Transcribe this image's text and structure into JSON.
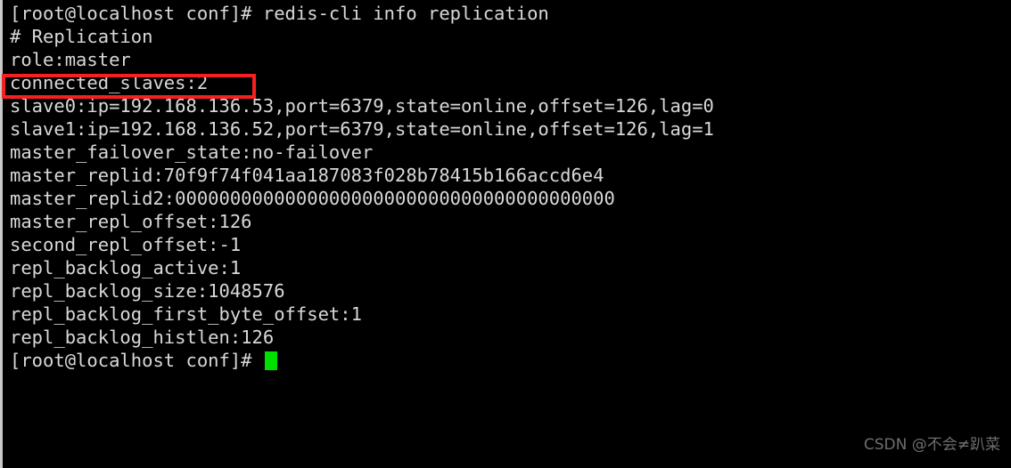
{
  "terminal": {
    "background_color": "#000000",
    "foreground_color": "#d8d8d8",
    "cursor_color": "#00e000",
    "lines": [
      {
        "id": "command-prompt-line",
        "text": "[root@localhost conf]# redis-cli info replication"
      },
      {
        "id": "section-header-line",
        "text": "# Replication"
      },
      {
        "id": "role-line",
        "text": "role:master"
      },
      {
        "id": "connected-slaves-line",
        "text": "connected_slaves:2"
      },
      {
        "id": "slave0-line",
        "text": "slave0:ip=192.168.136.53,port=6379,state=online,offset=126,lag=0"
      },
      {
        "id": "slave1-line",
        "text": "slave1:ip=192.168.136.52,port=6379,state=online,offset=126,lag=1"
      },
      {
        "id": "master-failover-state-line",
        "text": "master_failover_state:no-failover"
      },
      {
        "id": "master-replid-line",
        "text": "master_replid:70f9f74f041aa187083f028b78415b166accd6e4"
      },
      {
        "id": "master-replid2-line",
        "text": "master_replid2:0000000000000000000000000000000000000000"
      },
      {
        "id": "master-repl-offset-line",
        "text": "master_repl_offset:126"
      },
      {
        "id": "second-repl-offset-line",
        "text": "second_repl_offset:-1"
      },
      {
        "id": "repl-backlog-active-line",
        "text": "repl_backlog_active:1"
      },
      {
        "id": "repl-backlog-size-line",
        "text": "repl_backlog_size:1048576"
      },
      {
        "id": "repl-backlog-first-byte-offset-line",
        "text": "repl_backlog_first_byte_offset:1"
      },
      {
        "id": "repl-backlog-histlen-line",
        "text": "repl_backlog_histlen:126"
      }
    ],
    "final_prompt": "[root@localhost conf]# "
  },
  "annotation": {
    "highlight_color": "#f52020",
    "highlight_target": "connected_slaves:2"
  },
  "watermark": {
    "text": "CSDN @不会≠趴菜",
    "color": "#6e6e6e"
  }
}
